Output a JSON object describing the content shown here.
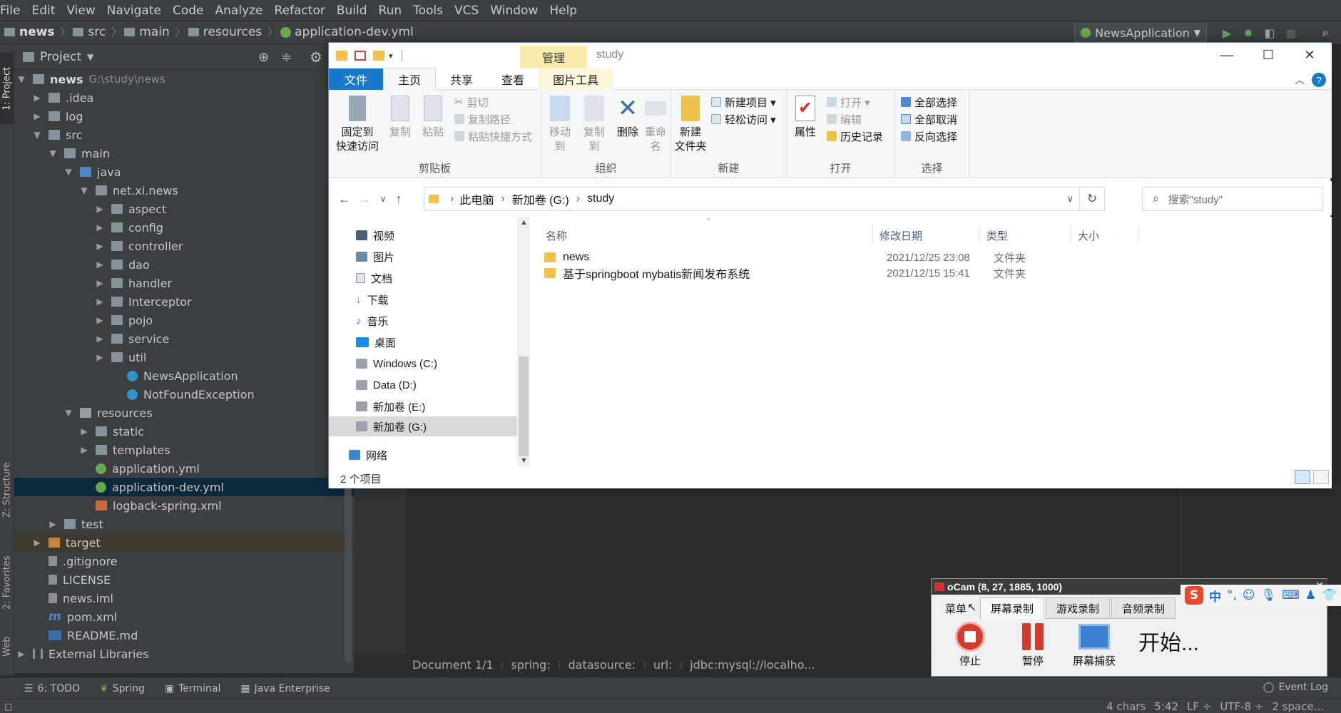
{
  "ide": {
    "menu": [
      "File",
      "Edit",
      "View",
      "Navigate",
      "Code",
      "Analyze",
      "Refactor",
      "Build",
      "Run",
      "Tools",
      "VCS",
      "Window",
      "Help"
    ],
    "breadcrumb": [
      "news",
      "src",
      "main",
      "resources",
      "application-dev.yml"
    ],
    "run_config": "NewsApplication",
    "project_panel": {
      "title": "Project",
      "tree": [
        {
          "label": "news",
          "extra": "G:\\study\\news"
        },
        {
          "label": ".idea"
        },
        {
          "label": "log"
        },
        {
          "label": "src"
        },
        {
          "label": "main"
        },
        {
          "label": "java"
        },
        {
          "label": "net.xi.news"
        },
        {
          "label": "aspect"
        },
        {
          "label": "config"
        },
        {
          "label": "controller"
        },
        {
          "label": "dao"
        },
        {
          "label": "handler"
        },
        {
          "label": "Interceptor"
        },
        {
          "label": "pojo"
        },
        {
          "label": "service"
        },
        {
          "label": "util"
        },
        {
          "label": "NewsApplication"
        },
        {
          "label": "NotFoundException"
        },
        {
          "label": "resources"
        },
        {
          "label": "static"
        },
        {
          "label": "templates"
        },
        {
          "label": "application.yml"
        },
        {
          "label": "application-dev.yml"
        },
        {
          "label": "logback-spring.xml"
        },
        {
          "label": "test"
        },
        {
          "label": "target"
        },
        {
          "label": ".gitignore"
        },
        {
          "label": "LICENSE"
        },
        {
          "label": "news.iml"
        },
        {
          "label": "pom.xml"
        },
        {
          "label": "README.md"
        },
        {
          "label": "External Libraries"
        }
      ]
    },
    "left_strip": [
      "1: Project",
      "Z: Structure",
      "2: Favorites",
      "Web"
    ],
    "editor_breadcrumb": [
      "Document 1/1",
      "spring:",
      "datasource:",
      "url:",
      "jdbc:mysql://localho..."
    ],
    "bottom_tools": [
      "6: TODO",
      "Spring",
      "Terminal",
      "Java Enterprise"
    ],
    "event_log": "Event Log",
    "status": [
      "4 chars",
      "5:42",
      "LF ÷",
      "UTF-8 ÷",
      "2 space..."
    ]
  },
  "explorer": {
    "window_title": "study",
    "manage_tab": "管理",
    "ribbon_tabs": [
      "文件",
      "主页",
      "共享",
      "查看",
      "图片工具"
    ],
    "ribbon": {
      "clipboard": {
        "label": "剪贴板",
        "pin": "固定到\n快速访问",
        "copy": "复制",
        "paste": "粘贴",
        "cut": "剪切",
        "copy_path": "复制路径",
        "paste_shortcut": "粘贴快捷方式"
      },
      "organize": {
        "label": "组织",
        "move_to": "移动到",
        "copy_to": "复制到",
        "delete": "删除",
        "rename": "重命名"
      },
      "new": {
        "label": "新建",
        "new_folder": "新建\n文件夹",
        "new_item": "新建项目 ▾",
        "easy_access": "轻松访问 ▾"
      },
      "open": {
        "label": "打开",
        "properties": "属性",
        "open": "打开 ▾",
        "edit": "编辑",
        "history": "历史记录"
      },
      "select": {
        "label": "选择",
        "select_all": "全部选择",
        "select_none": "全部取消",
        "invert": "反向选择"
      }
    },
    "address": [
      "此电脑",
      "新加卷 (G:)",
      "study"
    ],
    "search_placeholder": "搜索\"study\"",
    "nav": [
      "视频",
      "图片",
      "文档",
      "下载",
      "音乐",
      "桌面",
      "Windows (C:)",
      "Data (D:)",
      "新加卷 (E:)",
      "新加卷 (G:)",
      "网络"
    ],
    "columns": [
      "名称",
      "修改日期",
      "类型",
      "大小"
    ],
    "files": [
      {
        "name": "news",
        "date": "2021/12/25 23:08",
        "type": "文件夹"
      },
      {
        "name": "基于springboot mybatis新闻发布系统",
        "date": "2021/12/15 15:41",
        "type": "文件夹"
      }
    ],
    "item_count": "2 个项目"
  },
  "ocam": {
    "title": "oCam (8, 27, 1885, 1000)",
    "tabs": [
      "菜单",
      "屏幕录制",
      "游戏录制",
      "音频录制"
    ],
    "buttons": [
      "停止",
      "暂停",
      "屏幕捕获"
    ],
    "status": "开始..."
  },
  "ime": {
    "mode": "中"
  },
  "colors": {
    "ide_bg": "#2b2b2b",
    "panel_bg": "#3c3f41",
    "selection": "#0d293e",
    "file_tab": "#1979ca",
    "manage_tab": "#f6ebaa",
    "folder": "#f0c04a"
  }
}
